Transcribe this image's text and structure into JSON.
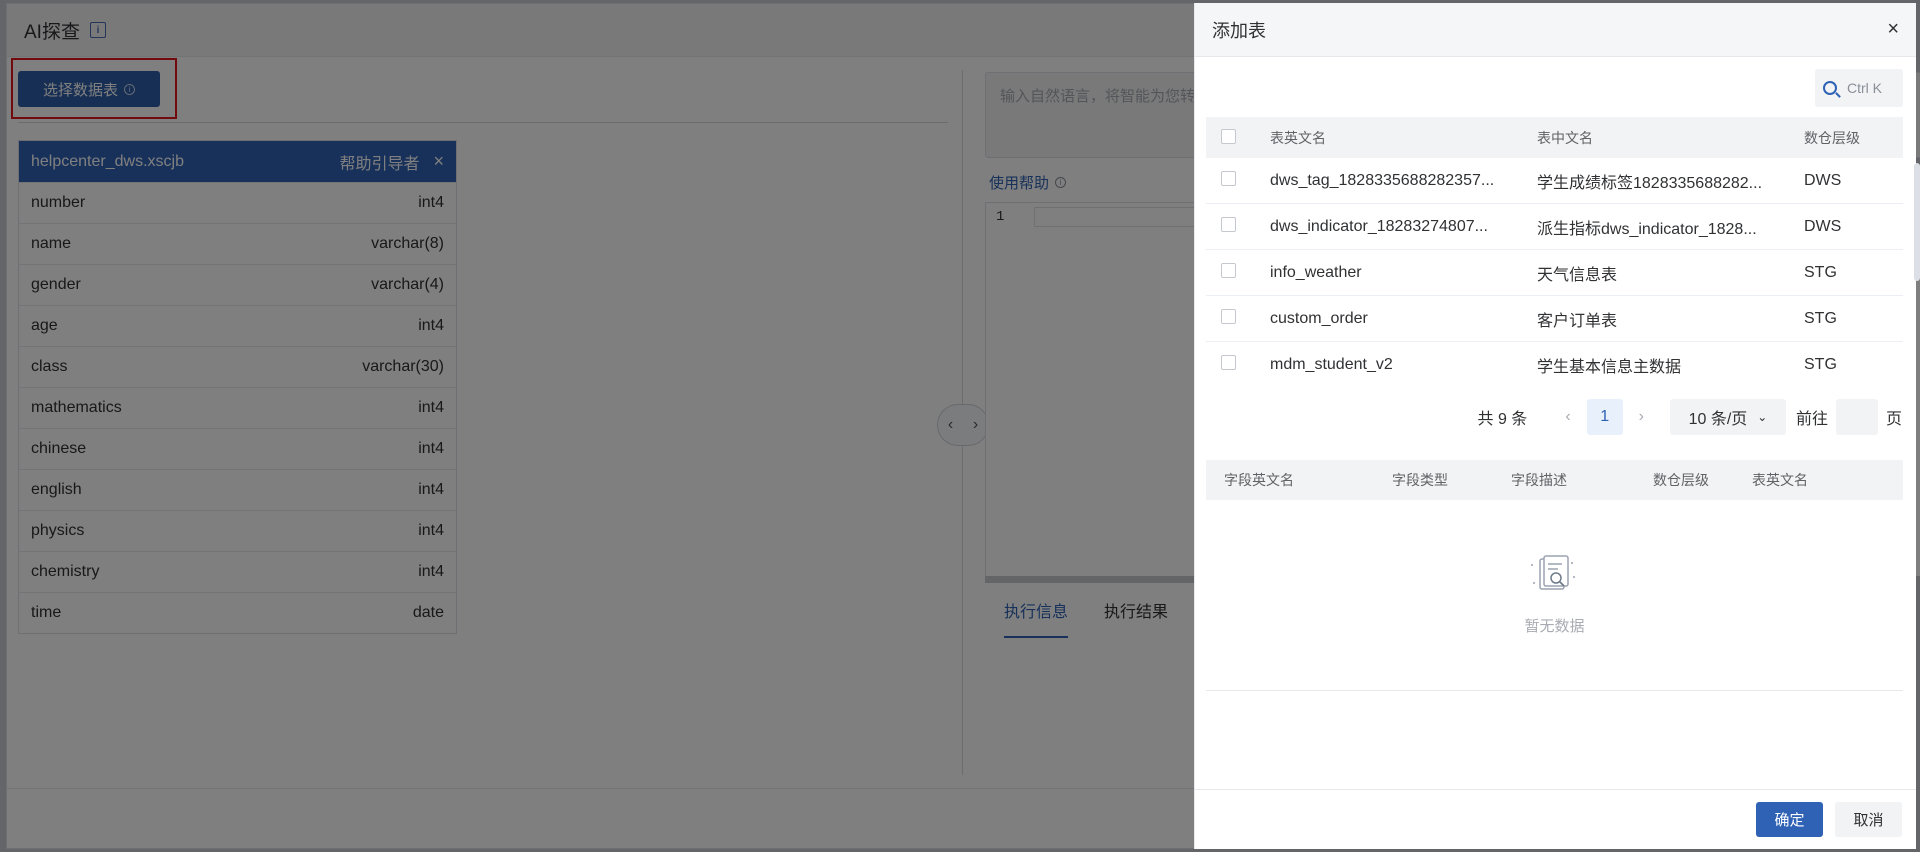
{
  "app": {
    "title": "AI探查",
    "select_button": "选择数据表",
    "info_glyph": "i",
    "nl_placeholder": "输入自然语言，将智能为您转",
    "help_label": "使用帮助",
    "editor_line_no": "1",
    "tabs": [
      "执行信息",
      "执行结果"
    ],
    "selected_table": {
      "name": "helpcenter_dws.xscjb",
      "sub": "帮助引导者",
      "fields": [
        {
          "name": "number",
          "type": "int4"
        },
        {
          "name": "name",
          "type": "varchar(8)"
        },
        {
          "name": "gender",
          "type": "varchar(4)"
        },
        {
          "name": "age",
          "type": "int4"
        },
        {
          "name": "class",
          "type": "varchar(30)"
        },
        {
          "name": "mathematics",
          "type": "int4"
        },
        {
          "name": "chinese",
          "type": "int4"
        },
        {
          "name": "english",
          "type": "int4"
        },
        {
          "name": "physics",
          "type": "int4"
        },
        {
          "name": "chemistry",
          "type": "int4"
        },
        {
          "name": "time",
          "type": "date"
        }
      ]
    }
  },
  "drawer": {
    "title": "添加表",
    "close_glyph": "×",
    "search_shortcut": "Ctrl K",
    "columns": {
      "en": "表英文名",
      "cn": "表中文名",
      "level": "数仓层级"
    },
    "rows": [
      {
        "en": "dws_tag_1828335688282357...",
        "cn": "学生成绩标签1828335688282...",
        "level": "DWS"
      },
      {
        "en": "dws_indicator_18283274807...",
        "cn": "派生指标dws_indicator_1828...",
        "level": "DWS"
      },
      {
        "en": "info_weather",
        "cn": "天气信息表",
        "level": "STG"
      },
      {
        "en": "custom_order",
        "cn": "客户订单表",
        "level": "STG"
      },
      {
        "en": "mdm_student_v2",
        "cn": "学生基本信息主数据",
        "level": "STG"
      }
    ],
    "pager": {
      "total": "共 9 条",
      "current": "1",
      "size": "10 条/页",
      "goto": "前往",
      "page_suffix": "页",
      "prev": "‹",
      "next": "›",
      "chevron": "⌄"
    },
    "field_columns": {
      "en": "字段英文名",
      "type": "字段类型",
      "desc": "字段描述",
      "level": "数仓层级",
      "table": "表英文名"
    },
    "empty_text": "暂无数据",
    "ok": "确定",
    "cancel": "取消"
  }
}
